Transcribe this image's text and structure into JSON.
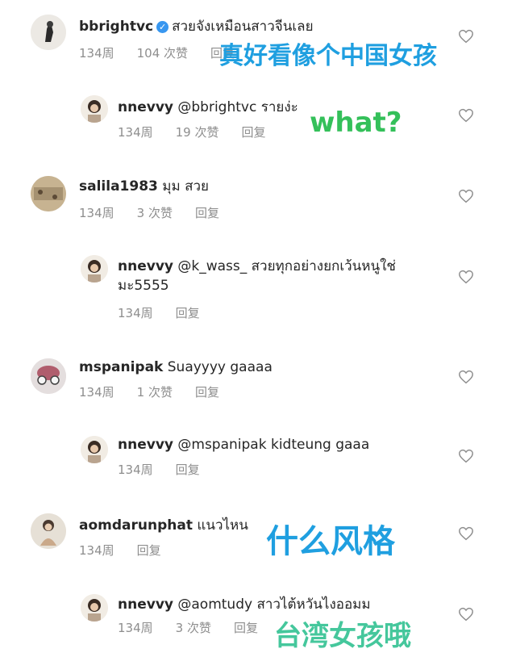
{
  "comments": [
    {
      "username": "bbrightvc",
      "verified": true,
      "text": "สวยจังเหมือนสาวจีนเลย",
      "age": "134周",
      "likes": "104 次赞",
      "reply": "回复"
    },
    {
      "username": "nnevvy",
      "text": "@bbrightvc รายง่ะ",
      "age": "134周",
      "likes": "19 次赞",
      "reply": "回复"
    },
    {
      "username": "salila1983",
      "text": "มุม สวย",
      "age": "134周",
      "likes": "3 次赞",
      "reply": "回复"
    },
    {
      "username": "nnevvy",
      "text": "@k_wass_ สวยทุกอย่างยกเว้นหนูใช่",
      "text_line2": "มะ5555",
      "age": "134周",
      "reply": "回复"
    },
    {
      "username": "mspanipak",
      "text": "Suayyyy gaaaa",
      "age": "134周",
      "likes": "1 次赞",
      "reply": "回复"
    },
    {
      "username": "nnevvy",
      "text": "@mspanipak kidteung gaaa",
      "age": "134周",
      "reply": "回复"
    },
    {
      "username": "aomdarunphat",
      "text": "แนวไหน",
      "age": "134周",
      "reply": "回复"
    },
    {
      "username": "nnevvy",
      "text": "@aomtudy สาวไต้หวันไงออมม",
      "age": "134周",
      "likes": "3 次赞",
      "reply": "回复"
    }
  ],
  "overlays": {
    "caption1": "真好看像个中国女孩",
    "caption2": "what?",
    "caption3": "什么风格",
    "caption4": "台湾女孩哦"
  },
  "icons": {
    "like": "heart-outline-icon",
    "verified": "verified-badge-icon"
  },
  "colors": {
    "meta": "#8e8e8e",
    "verified": "#3897f0",
    "caption_blue": "#1f9fe0",
    "caption_green": "#34c05a"
  }
}
